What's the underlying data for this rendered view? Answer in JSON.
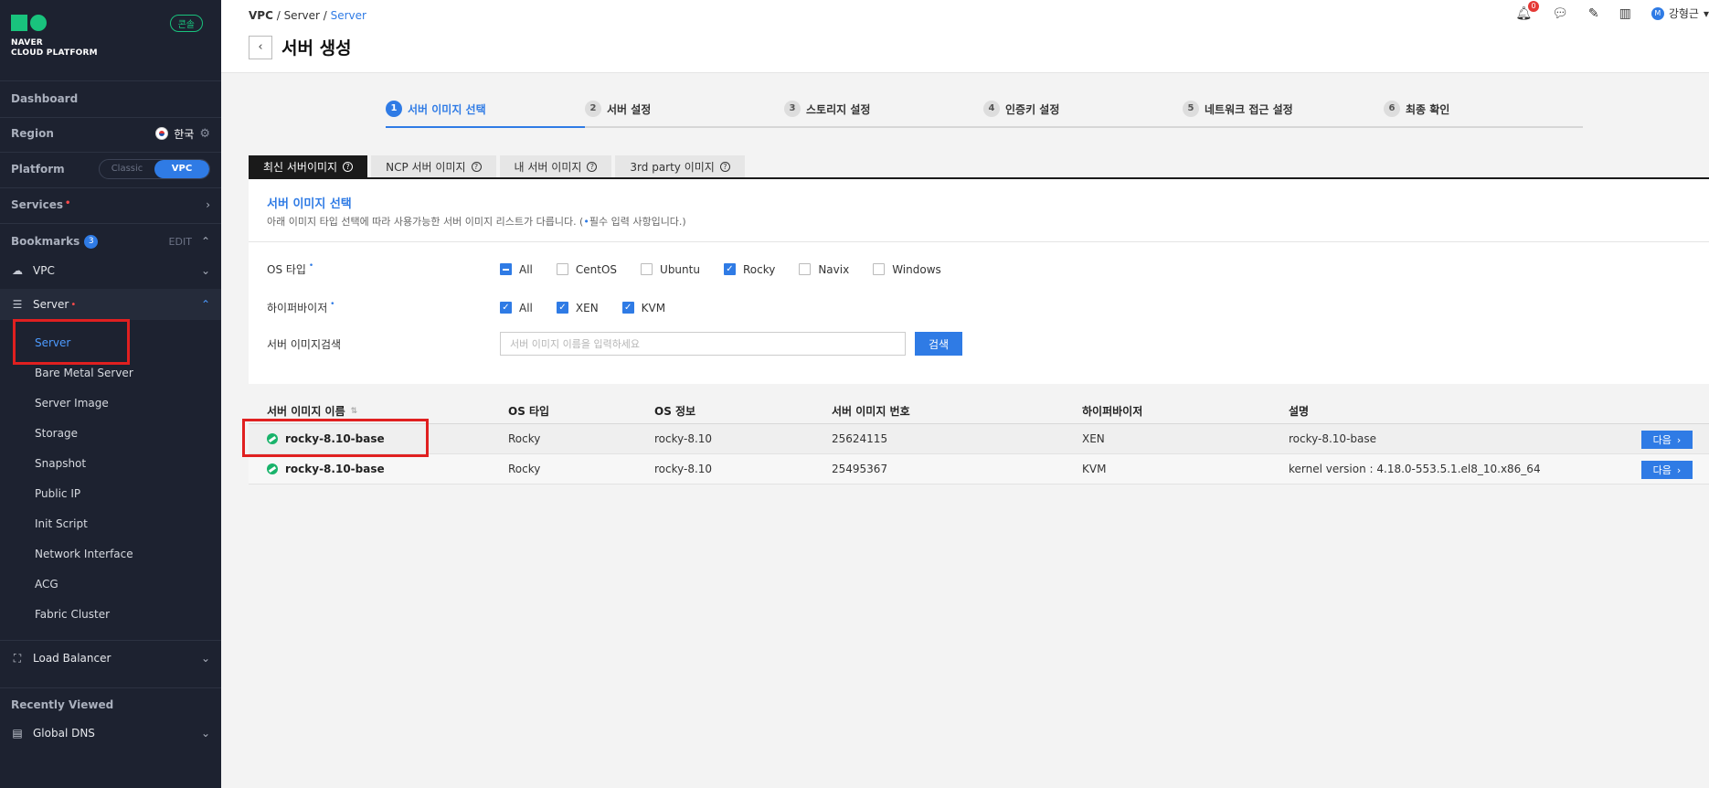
{
  "sidebar": {
    "brand_line1": "NAVER",
    "brand_line2": "CLOUD PLATFORM",
    "console_badge": "콘솔",
    "dashboard": "Dashboard",
    "region_label": "Region",
    "region_value": "한국",
    "platform_label": "Platform",
    "platform_classic": "Classic",
    "platform_vpc": "VPC",
    "services": "Services",
    "bookmarks": "Bookmarks",
    "bookmarks_count": "3",
    "edit": "EDIT",
    "vpc": "VPC",
    "server": "Server",
    "submenu": [
      "Server",
      "Bare Metal Server",
      "Server Image",
      "Storage",
      "Snapshot",
      "Public IP",
      "Init Script",
      "Network Interface",
      "ACG",
      "Fabric Cluster"
    ],
    "load_balancer": "Load Balancer",
    "recently_viewed": "Recently Viewed",
    "global_dns": "Global DNS"
  },
  "header": {
    "breadcrumb": [
      "VPC",
      "Server",
      "Server"
    ],
    "title": "서버 생성",
    "notification_count": "0",
    "user_initial": "M",
    "user_name": "강형근"
  },
  "steps": [
    {
      "num": "1",
      "label": "서버 이미지 선택"
    },
    {
      "num": "2",
      "label": "서버 설정"
    },
    {
      "num": "3",
      "label": "스토리지 설정"
    },
    {
      "num": "4",
      "label": "인증키 설정"
    },
    {
      "num": "5",
      "label": "네트워크 접근 설정"
    },
    {
      "num": "6",
      "label": "최종 확인"
    }
  ],
  "tabs": [
    "최신 서버이미지",
    "NCP 서버 이미지",
    "내 서버 이미지",
    "3rd party 이미지"
  ],
  "panel": {
    "title": "서버 이미지 선택",
    "desc_prefix": "아래 이미지 타입 선택에 따라 사용가능한 서버 이미지 리스트가 다릅니다. (",
    "desc_suffix": "필수 입력 사항입니다.)",
    "os_label": "OS 타입",
    "os_options": [
      "All",
      "CentOS",
      "Ubuntu",
      "Rocky",
      "Navix",
      "Windows"
    ],
    "hv_label": "하이퍼바이저",
    "hv_options": [
      "All",
      "XEN",
      "KVM"
    ],
    "search_label": "서버 이미지검색",
    "search_placeholder": "서버 이미지 이름을 입력하세요",
    "search_button": "검색"
  },
  "table": {
    "headers": [
      "서버 이미지 이름",
      "OS 타입",
      "OS 정보",
      "서버 이미지 번호",
      "하이퍼바이저",
      "설명"
    ],
    "rows": [
      {
        "name": "rocky-8.10-base",
        "os_type": "Rocky",
        "os_info": "rocky-8.10",
        "image_no": "25624115",
        "hypervisor": "XEN",
        "desc": "rocky-8.10-base",
        "action": "다음"
      },
      {
        "name": "rocky-8.10-base",
        "os_type": "Rocky",
        "os_info": "rocky-8.10",
        "image_no": "25495367",
        "hypervisor": "KVM",
        "desc": "kernel version : 4.18.0-553.5.1.el8_10.x86_64",
        "action": "다음"
      }
    ]
  }
}
